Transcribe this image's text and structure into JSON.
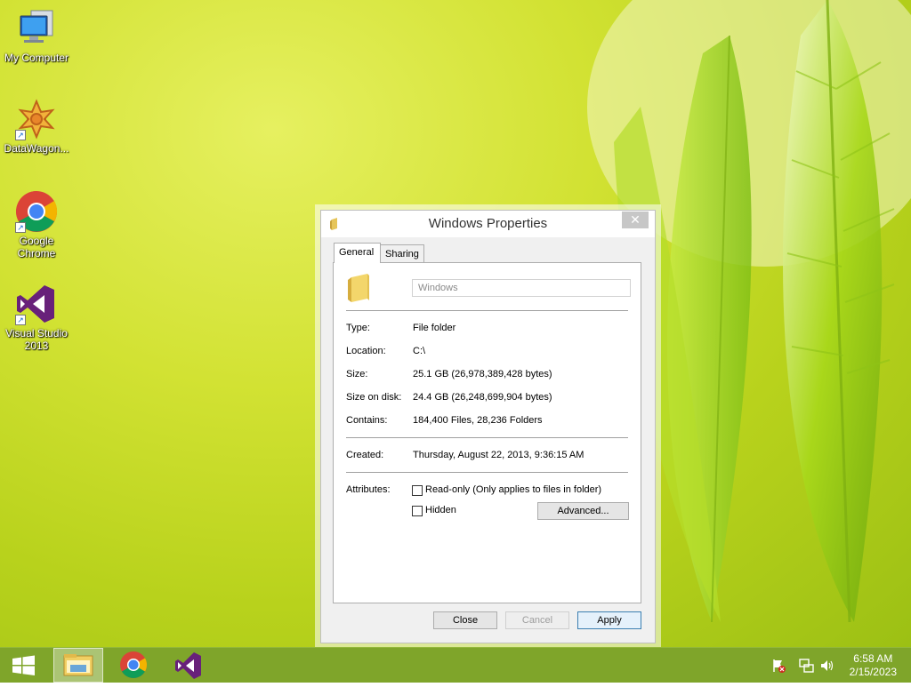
{
  "desktop": {
    "icons": [
      {
        "label": "My Computer",
        "icon": "computer-icon"
      },
      {
        "label": "DataWagon...",
        "icon": "datawagon-icon"
      },
      {
        "label": "Google Chrome",
        "icon": "chrome-icon"
      },
      {
        "label": "Visual Studio 2013",
        "icon": "visual-studio-icon"
      }
    ]
  },
  "dialog": {
    "title": "Windows Properties",
    "close_glyph": "✕",
    "tabs": [
      {
        "label": "General",
        "active": true
      },
      {
        "label": "Sharing",
        "active": false
      }
    ],
    "name_value": "Windows",
    "properties": [
      {
        "label": "Type:",
        "value": "File folder"
      },
      {
        "label": "Location:",
        "value": "C:\\"
      },
      {
        "label": "Size:",
        "value": "25.1 GB (26,978,389,428 bytes)"
      },
      {
        "label": "Size on disk:",
        "value": "24.4 GB (26,248,699,904 bytes)"
      },
      {
        "label": "Contains:",
        "value": "184,400 Files, 28,236 Folders"
      }
    ],
    "created": {
      "label": "Created:",
      "value": "Thursday, August 22, 2013, 9:36:15 AM"
    },
    "attributes": {
      "label": "Attributes:",
      "readonly": {
        "label": "Read-only (Only applies to files in folder)",
        "checked": false
      },
      "hidden": {
        "label": "Hidden",
        "checked": false
      },
      "advanced_button": "Advanced..."
    },
    "buttons": {
      "close": "Close",
      "cancel": "Cancel",
      "apply": "Apply"
    }
  },
  "taskbar": {
    "items": [
      "start-button",
      "file-explorer",
      "google-chrome",
      "visual-studio"
    ],
    "tray": [
      "action-center-icon",
      "network-icon",
      "volume-icon"
    ],
    "time": "6:58 AM",
    "date": "2/15/2023"
  },
  "colors": {
    "desktop_accent": "#b8d21c",
    "taskbar": "#7fa52a",
    "default_button_border": "#3c7fb1"
  }
}
